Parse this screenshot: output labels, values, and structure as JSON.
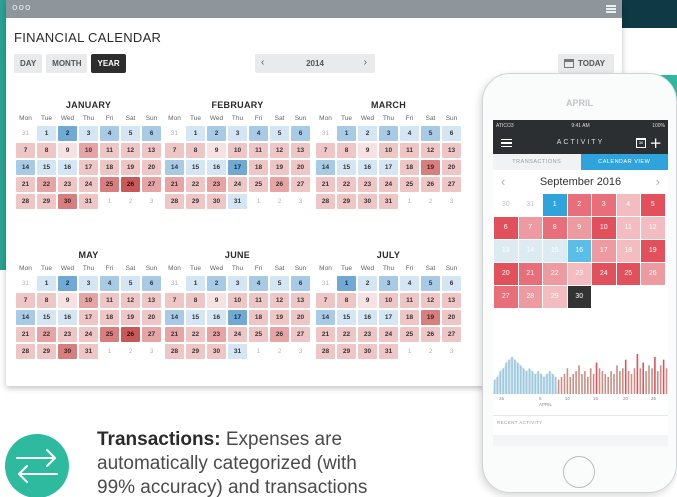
{
  "window": {
    "controls_glyph": "ooo",
    "title": "FINANCIAL CALENDAR",
    "view_buttons": [
      "DAY",
      "MONTH",
      "YEAR"
    ],
    "active_view": "YEAR",
    "year": "2014",
    "today_label": "TODAY"
  },
  "calendar": {
    "weekdays": [
      "Mon",
      "Tue",
      "Wed",
      "Thu",
      "Fri",
      "Sat",
      "Sun"
    ],
    "months": [
      {
        "name": "JANUARY",
        "days": [
          [
            "31",
            "m"
          ],
          [
            "1",
            "b1"
          ],
          [
            "2",
            "b3"
          ],
          [
            "3",
            "b1"
          ],
          [
            "4",
            "b2"
          ],
          [
            "5",
            "b1"
          ],
          [
            "6",
            "b2"
          ],
          [
            "7",
            "1"
          ],
          [
            "8",
            "1"
          ],
          [
            "9",
            "0"
          ],
          [
            "10",
            "2"
          ],
          [
            "11",
            "1"
          ],
          [
            "12",
            "1"
          ],
          [
            "13",
            "1"
          ],
          [
            "14",
            "b2"
          ],
          [
            "15",
            "b1"
          ],
          [
            "16",
            "b1"
          ],
          [
            "17",
            "1"
          ],
          [
            "18",
            "1"
          ],
          [
            "19",
            "1"
          ],
          [
            "20",
            "1"
          ],
          [
            "21",
            "1"
          ],
          [
            "22",
            "2"
          ],
          [
            "23",
            "1"
          ],
          [
            "24",
            "1"
          ],
          [
            "25",
            "3"
          ],
          [
            "26",
            "4"
          ],
          [
            "27",
            "2"
          ],
          [
            "28",
            "1"
          ],
          [
            "29",
            "1"
          ],
          [
            "30",
            "3"
          ],
          [
            "31",
            "1"
          ],
          [
            "1",
            "m"
          ],
          [
            "2",
            "m"
          ],
          [
            "3",
            "m"
          ]
        ]
      },
      {
        "name": "FEBRUARY",
        "days": [
          [
            "31",
            "m"
          ],
          [
            "1",
            "b1"
          ],
          [
            "2",
            "b2"
          ],
          [
            "3",
            "b1"
          ],
          [
            "4",
            "b2"
          ],
          [
            "5",
            "b1"
          ],
          [
            "6",
            "b2"
          ],
          [
            "7",
            "1"
          ],
          [
            "8",
            "1"
          ],
          [
            "9",
            "0"
          ],
          [
            "10",
            "1"
          ],
          [
            "11",
            "1"
          ],
          [
            "12",
            "1"
          ],
          [
            "13",
            "1"
          ],
          [
            "14",
            "b2"
          ],
          [
            "15",
            "b1"
          ],
          [
            "16",
            "b1"
          ],
          [
            "17",
            "b3"
          ],
          [
            "18",
            "1"
          ],
          [
            "19",
            "1"
          ],
          [
            "20",
            "1"
          ],
          [
            "21",
            "2"
          ],
          [
            "22",
            "1"
          ],
          [
            "23",
            "2"
          ],
          [
            "24",
            "1"
          ],
          [
            "25",
            "1"
          ],
          [
            "26",
            "2"
          ],
          [
            "27",
            "1"
          ],
          [
            "28",
            "1"
          ],
          [
            "29",
            "1"
          ],
          [
            "30",
            "1"
          ],
          [
            "31",
            "b1"
          ],
          [
            "1",
            "m"
          ],
          [
            "2",
            "m"
          ],
          [
            "3",
            "m"
          ]
        ]
      },
      {
        "name": "MARCH",
        "days": [
          [
            "31",
            "m"
          ],
          [
            "1",
            "b2"
          ],
          [
            "2",
            "b1"
          ],
          [
            "3",
            "b2"
          ],
          [
            "4",
            "b1"
          ],
          [
            "5",
            "b2"
          ],
          [
            "6",
            "b1"
          ],
          [
            "7",
            "1"
          ],
          [
            "8",
            "1"
          ],
          [
            "9",
            "0"
          ],
          [
            "10",
            "1"
          ],
          [
            "11",
            "1"
          ],
          [
            "12",
            "1"
          ],
          [
            "13",
            "1"
          ],
          [
            "14",
            "b2"
          ],
          [
            "15",
            "b1"
          ],
          [
            "16",
            "b1"
          ],
          [
            "17",
            "b1"
          ],
          [
            "18",
            "1"
          ],
          [
            "19",
            "3"
          ],
          [
            "20",
            "1"
          ],
          [
            "21",
            "1"
          ],
          [
            "22",
            "1"
          ],
          [
            "23",
            "1"
          ],
          [
            "24",
            "1"
          ],
          [
            "25",
            "1"
          ],
          [
            "26",
            "1"
          ],
          [
            "27",
            "1"
          ],
          [
            "28",
            "1"
          ],
          [
            "29",
            "1"
          ],
          [
            "30",
            "1"
          ],
          [
            "31",
            "1"
          ],
          [
            "1",
            "m"
          ],
          [
            "2",
            "m"
          ],
          [
            "3",
            "m"
          ]
        ]
      },
      {
        "name": "MAY",
        "days": [
          [
            "31",
            "m"
          ],
          [
            "1",
            "b1"
          ],
          [
            "2",
            "b3"
          ],
          [
            "3",
            "b1"
          ],
          [
            "4",
            "b2"
          ],
          [
            "5",
            "b1"
          ],
          [
            "6",
            "b2"
          ],
          [
            "7",
            "1"
          ],
          [
            "8",
            "1"
          ],
          [
            "9",
            "0"
          ],
          [
            "10",
            "2"
          ],
          [
            "11",
            "1"
          ],
          [
            "12",
            "1"
          ],
          [
            "13",
            "1"
          ],
          [
            "14",
            "b2"
          ],
          [
            "15",
            "b1"
          ],
          [
            "16",
            "b1"
          ],
          [
            "17",
            "1"
          ],
          [
            "18",
            "1"
          ],
          [
            "19",
            "1"
          ],
          [
            "20",
            "1"
          ],
          [
            "21",
            "1"
          ],
          [
            "22",
            "2"
          ],
          [
            "23",
            "1"
          ],
          [
            "24",
            "1"
          ],
          [
            "25",
            "3"
          ],
          [
            "26",
            "4"
          ],
          [
            "27",
            "2"
          ],
          [
            "28",
            "1"
          ],
          [
            "29",
            "1"
          ],
          [
            "30",
            "3"
          ],
          [
            "31",
            "1"
          ],
          [
            "1",
            "m"
          ],
          [
            "2",
            "m"
          ],
          [
            "3",
            "m"
          ]
        ]
      },
      {
        "name": "JUNE",
        "days": [
          [
            "31",
            "m"
          ],
          [
            "1",
            "b1"
          ],
          [
            "2",
            "b2"
          ],
          [
            "3",
            "b1"
          ],
          [
            "4",
            "b2"
          ],
          [
            "5",
            "b1"
          ],
          [
            "6",
            "b2"
          ],
          [
            "7",
            "1"
          ],
          [
            "8",
            "1"
          ],
          [
            "9",
            "0"
          ],
          [
            "10",
            "1"
          ],
          [
            "11",
            "1"
          ],
          [
            "12",
            "1"
          ],
          [
            "13",
            "1"
          ],
          [
            "14",
            "b2"
          ],
          [
            "15",
            "b1"
          ],
          [
            "16",
            "b1"
          ],
          [
            "17",
            "b3"
          ],
          [
            "18",
            "1"
          ],
          [
            "19",
            "1"
          ],
          [
            "20",
            "1"
          ],
          [
            "21",
            "2"
          ],
          [
            "22",
            "1"
          ],
          [
            "23",
            "2"
          ],
          [
            "24",
            "1"
          ],
          [
            "25",
            "1"
          ],
          [
            "26",
            "2"
          ],
          [
            "27",
            "1"
          ],
          [
            "28",
            "1"
          ],
          [
            "29",
            "1"
          ],
          [
            "30",
            "1"
          ],
          [
            "31",
            "b1"
          ],
          [
            "1",
            "m"
          ],
          [
            "2",
            "m"
          ],
          [
            "3",
            "m"
          ]
        ]
      },
      {
        "name": "JULY",
        "days": [
          [
            "31",
            "m"
          ],
          [
            "1",
            "b3"
          ],
          [
            "2",
            "b1"
          ],
          [
            "3",
            "b2"
          ],
          [
            "4",
            "b1"
          ],
          [
            "5",
            "b2"
          ],
          [
            "6",
            "b1"
          ],
          [
            "7",
            "1"
          ],
          [
            "8",
            "1"
          ],
          [
            "9",
            "0"
          ],
          [
            "10",
            "1"
          ],
          [
            "11",
            "1"
          ],
          [
            "12",
            "1"
          ],
          [
            "13",
            "1"
          ],
          [
            "14",
            "b2"
          ],
          [
            "15",
            "b1"
          ],
          [
            "16",
            "b1"
          ],
          [
            "17",
            "b1"
          ],
          [
            "18",
            "1"
          ],
          [
            "19",
            "3"
          ],
          [
            "20",
            "1"
          ],
          [
            "21",
            "1"
          ],
          [
            "22",
            "1"
          ],
          [
            "23",
            "1"
          ],
          [
            "24",
            "1"
          ],
          [
            "25",
            "1"
          ],
          [
            "26",
            "1"
          ],
          [
            "27",
            "1"
          ],
          [
            "28",
            "1"
          ],
          [
            "29",
            "1"
          ],
          [
            "30",
            "1"
          ],
          [
            "31",
            "1"
          ],
          [
            "1",
            "m"
          ],
          [
            "2",
            "m"
          ],
          [
            "3",
            "m"
          ]
        ]
      }
    ]
  },
  "phone": {
    "behind_month_label": "APRIL",
    "status": {
      "carrier": "ATICO3",
      "time": "9:41 AM",
      "battery": "100%"
    },
    "app_title": "ACTIVITY",
    "tabs": [
      "TRANSACTIONS",
      "CALENDAR VIEW"
    ],
    "active_tab": "CALENDAR VIEW",
    "month_label": "September 2016",
    "days": [
      [
        "30",
        "m"
      ],
      [
        "31",
        "m"
      ],
      [
        "1",
        "b1"
      ],
      [
        "2",
        "2"
      ],
      [
        "3",
        "2"
      ],
      [
        "4",
        "0"
      ],
      [
        "5",
        "3"
      ],
      [
        "6",
        "3"
      ],
      [
        "7",
        "1"
      ],
      [
        "8",
        "2"
      ],
      [
        "9",
        "1"
      ],
      [
        "10",
        "3"
      ],
      [
        "11",
        "0"
      ],
      [
        "12",
        "0"
      ],
      [
        "13",
        "b0"
      ],
      [
        "14",
        "b0"
      ],
      [
        "15",
        "b0"
      ],
      [
        "16",
        "b2"
      ],
      [
        "17",
        "1"
      ],
      [
        "18",
        "0"
      ],
      [
        "19",
        "3"
      ],
      [
        "20",
        "3"
      ],
      [
        "21",
        "2"
      ],
      [
        "22",
        "1"
      ],
      [
        "23",
        "0"
      ],
      [
        "24",
        "3"
      ],
      [
        "25",
        "3"
      ],
      [
        "26",
        "1"
      ],
      [
        "27",
        "2"
      ],
      [
        "28",
        "1"
      ],
      [
        "29",
        "0"
      ],
      [
        "30",
        "sel"
      ]
    ],
    "sparkline": [
      5,
      6,
      8,
      9,
      11,
      12,
      13,
      12,
      11,
      10,
      9,
      8,
      9,
      8,
      7,
      8,
      7,
      6,
      7,
      8,
      7,
      6,
      5,
      6,
      7,
      9,
      6,
      7,
      8,
      10,
      7,
      8,
      6,
      9,
      7,
      11,
      9,
      8,
      7,
      6,
      8,
      7,
      10,
      8,
      9,
      12,
      8,
      7,
      9,
      14,
      9,
      11,
      8,
      10,
      9,
      13,
      8,
      10,
      12,
      9
    ],
    "axis_labels": [
      "25",
      "5",
      "10",
      "15",
      "20",
      "25"
    ],
    "axis_sub": "APRIL",
    "recent_label": "RECENT ACTIVITY"
  },
  "caption": {
    "bold": "Transactions:",
    "line1": " Expenses are",
    "line2": "automatically categorized (with",
    "line3": "99% accuracy) and transactions"
  },
  "colors": {
    "teal": "#2dba9e",
    "dark": "#0f3a45",
    "accent_blue": "#2fa4dc",
    "accent_red": "#e2505c"
  }
}
